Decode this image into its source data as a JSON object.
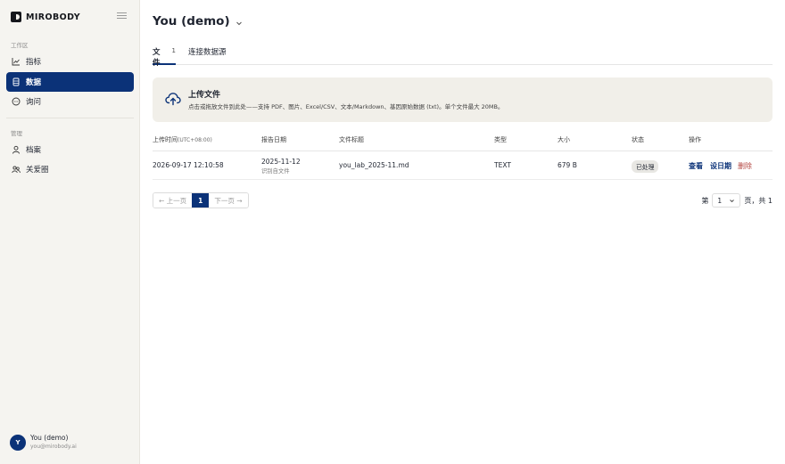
{
  "sidebar": {
    "brand": "MIROBODY",
    "workspace_label": "工作区",
    "manage_label": "管理",
    "items": [
      {
        "label": "指标",
        "icon": "chart-line-icon"
      },
      {
        "label": "数据",
        "icon": "database-icon"
      },
      {
        "label": "询问",
        "icon": "chat-icon"
      },
      {
        "label": "档案",
        "icon": "user-icon"
      },
      {
        "label": "关爱圈",
        "icon": "people-icon"
      }
    ],
    "active_item": "数据",
    "user": {
      "initial": "Y",
      "name": "You (demo)",
      "email": "you@mirobody.ai"
    }
  },
  "header": {
    "title": "You (demo)"
  },
  "tabs": [
    {
      "label": "文件",
      "count": "1"
    },
    {
      "label": "连接数据源",
      "count": ""
    }
  ],
  "upload": {
    "title": "上传文件",
    "description": "点击或拖放文件到此处——支持 PDF、图片、Excel/CSV、文本/Markdown、基因原始数据 (txt)。单个文件最大 20MB。"
  },
  "table": {
    "columns": {
      "upload_time": "上传时间",
      "upload_time_tz": "(UTC+08:00)",
      "report_date": "报告日期",
      "file_title": "文件标题",
      "type": "类型",
      "size": "大小",
      "status": "状态",
      "actions": "操作"
    },
    "rows": [
      {
        "upload_time": "2026-09-17 12:10:58",
        "report_date": "2025-11-12",
        "report_date_note": "识别自文件",
        "file_title": "you_lab_2025-11.md",
        "type": "TEXT",
        "size": "679 B",
        "status": "已处理",
        "actions": [
          "查看",
          "设日期",
          "删除"
        ]
      }
    ]
  },
  "pagination": {
    "prev": "← 上一页",
    "current": "1",
    "next": "下一页 →",
    "jump_prefix": "第",
    "jump_value": "1",
    "jump_suffix": "页，共 1"
  },
  "colors": {
    "accent": "#0b3278",
    "danger": "#b3443f",
    "sidebar_bg": "#f5f4f0",
    "upload_bg": "#f1efe9"
  }
}
